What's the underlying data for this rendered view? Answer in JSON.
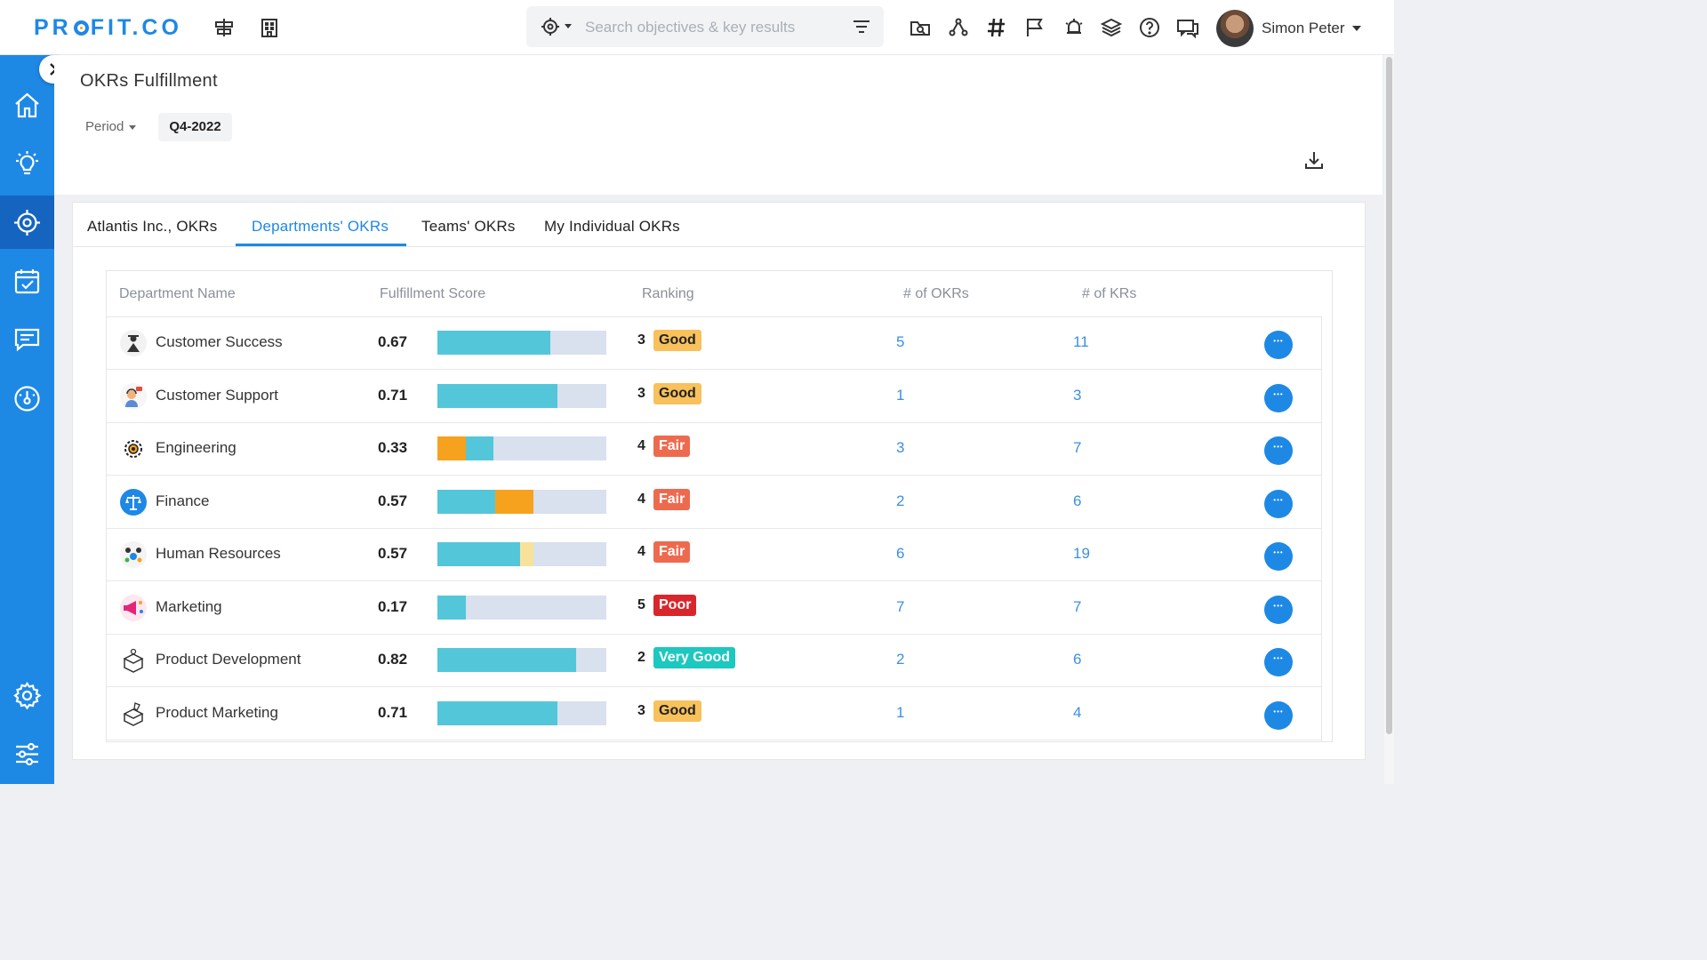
{
  "app": {
    "logo": "PROFIT.CO"
  },
  "search": {
    "placeholder": "Search objectives & key results",
    "value": ""
  },
  "user": {
    "name": "Simon Peter"
  },
  "topbar_icons": [
    "alignment-icon",
    "building-icon",
    "folder-search-icon",
    "hierarchy-icon",
    "hashtag-icon",
    "flag-icon",
    "alarm-icon",
    "layers-icon",
    "help-icon",
    "chat-icon"
  ],
  "sidebar": {
    "items": [
      {
        "name": "home-icon"
      },
      {
        "name": "lightbulb-icon"
      },
      {
        "name": "target-icon",
        "active": true
      },
      {
        "name": "calendar-check-icon"
      },
      {
        "name": "message-icon"
      },
      {
        "name": "dashboard-icon"
      },
      {
        "name": "settings-icon"
      },
      {
        "name": "sliders-icon"
      }
    ]
  },
  "page": {
    "title": "OKRs Fulfillment",
    "period_label": "Period",
    "period_value": "Q4-2022"
  },
  "tabs": [
    {
      "label": "Atlantis Inc., OKRs"
    },
    {
      "label": "Departments' OKRs",
      "active": true
    },
    {
      "label": "Teams' OKRs"
    },
    {
      "label": "My Individual OKRs"
    }
  ],
  "table": {
    "headers": {
      "department": "Department Name",
      "score": "Fulfillment Score",
      "ranking": "Ranking",
      "okrs": "# of OKRs",
      "krs": "# of KRs"
    },
    "rows": [
      {
        "name": "Customer Success",
        "score": "0.67",
        "rank": "3",
        "label": "Good",
        "okrs": "5",
        "krs": "11",
        "bar": [
          {
            "v": 0.67,
            "c": "#54c6d9"
          }
        ]
      },
      {
        "name": "Customer Support",
        "score": "0.71",
        "rank": "3",
        "label": "Good",
        "okrs": "1",
        "krs": "3",
        "bar": [
          {
            "v": 0.71,
            "c": "#54c6d9"
          }
        ]
      },
      {
        "name": "Engineering",
        "score": "0.33",
        "rank": "4",
        "label": "Fair",
        "okrs": "3",
        "krs": "7",
        "bar": [
          {
            "v": 0.17,
            "c": "#f6a21e"
          },
          {
            "v": 0.16,
            "c": "#54c6d9"
          }
        ]
      },
      {
        "name": "Finance",
        "score": "0.57",
        "rank": "4",
        "label": "Fair",
        "okrs": "2",
        "krs": "6",
        "bar": [
          {
            "v": 0.34,
            "c": "#54c6d9"
          },
          {
            "v": 0.23,
            "c": "#f6a21e"
          }
        ]
      },
      {
        "name": "Human Resources",
        "score": "0.57",
        "rank": "4",
        "label": "Fair",
        "okrs": "6",
        "krs": "19",
        "bar": [
          {
            "v": 0.49,
            "c": "#54c6d9"
          },
          {
            "v": 0.08,
            "c": "#f8e29a"
          }
        ]
      },
      {
        "name": "Marketing",
        "score": "0.17",
        "rank": "5",
        "label": "Poor",
        "okrs": "7",
        "krs": "7",
        "bar": [
          {
            "v": 0.17,
            "c": "#54c6d9"
          }
        ]
      },
      {
        "name": "Product Development",
        "score": "0.82",
        "rank": "2",
        "label": "Very Good",
        "okrs": "2",
        "krs": "6",
        "bar": [
          {
            "v": 0.82,
            "c": "#54c6d9"
          }
        ]
      },
      {
        "name": "Product Marketing",
        "score": "0.71",
        "rank": "3",
        "label": "Good",
        "okrs": "1",
        "krs": "4",
        "bar": [
          {
            "v": 0.71,
            "c": "#54c6d9"
          }
        ]
      }
    ]
  },
  "badge_colors": {
    "Good": {
      "bg": "#f8c15c",
      "fg": "#222222"
    },
    "Fair": {
      "bg": "#ee6a4f",
      "fg": "#ffffff"
    },
    "Poor": {
      "bg": "#d9262c",
      "fg": "#ffffff"
    },
    "Very Good": {
      "bg": "#1cc8c0",
      "fg": "#ffffff"
    }
  },
  "dept_icons": [
    "support-agent-icon",
    "headset-agent-icon",
    "gear-cog-icon",
    "scales-icon",
    "people-icon",
    "megaphone-icon",
    "box-idea-icon",
    "box-rocket-icon"
  ]
}
